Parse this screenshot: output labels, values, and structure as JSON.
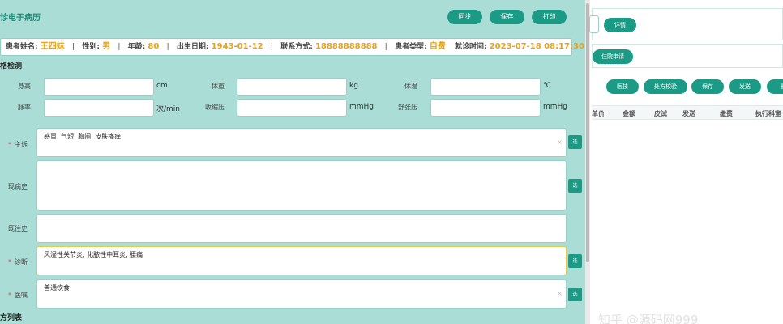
{
  "header": {
    "title": "门诊电子病历",
    "buttons": [
      "同步",
      "保存",
      "打印"
    ]
  },
  "patient": {
    "name_label": "患者姓名:",
    "name": "王四妹",
    "gender_label": "性别:",
    "gender": "男",
    "age_label": "年龄:",
    "age": "80",
    "birth_label": "出生日期:",
    "birth": "1943-01-12",
    "contact_label": "联系方式:",
    "contact": "18888888888",
    "type_label": "患者类型:",
    "type": "自费",
    "visit_label": "就诊时间:",
    "visit": "2023-07-18 08:17:30"
  },
  "vitals": {
    "section_title": "体格检测",
    "fields": [
      {
        "label": "身高",
        "unit": "cm",
        "value": ""
      },
      {
        "label": "体重",
        "unit": "kg",
        "value": ""
      },
      {
        "label": "体温",
        "unit": "℃",
        "value": ""
      },
      {
        "label": "脉率",
        "unit": "次/min",
        "value": ""
      },
      {
        "label": "收缩压",
        "unit": "mmHg",
        "value": ""
      },
      {
        "label": "舒张压",
        "unit": "mmHg",
        "value": ""
      }
    ]
  },
  "record": {
    "fields": [
      {
        "label": "主诉",
        "required": "*",
        "value": "感冒, 气短, 胸闷, 皮肤瘙痒",
        "clear": "×",
        "select": "选"
      },
      {
        "label": "现病史",
        "required": "",
        "value": "",
        "select": "选"
      },
      {
        "label": "既往史",
        "required": "",
        "value": ""
      },
      {
        "label": "诊断",
        "required": "*",
        "value": "风湿性关节炎, 化脓性中耳炎, 腰痛",
        "select": "选"
      },
      {
        "label": "医嘱",
        "required": "*",
        "value": "普通饮食",
        "clear": "×",
        "select": "选"
      }
    ],
    "prescription_section": "处方列表"
  },
  "right_panel": {
    "detail_button": "详情",
    "inpatient_button": "住院申请",
    "actions": [
      "医技",
      "处方校验",
      "保存",
      "发送",
      "删"
    ],
    "table_headers": [
      "单价",
      "金额",
      "皮试",
      "发送",
      "缴费",
      "执行科室"
    ]
  },
  "watermark": "知乎 @源码网999"
}
